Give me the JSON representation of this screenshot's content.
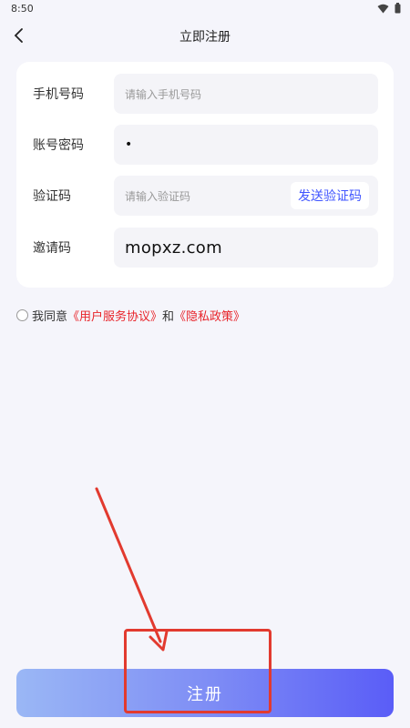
{
  "status_bar": {
    "time": "8:50",
    "icons": [
      "wifi-icon",
      "battery-icon"
    ]
  },
  "nav": {
    "back_icon": "chevron-left-icon",
    "title": "立即注册"
  },
  "form": {
    "phone": {
      "label": "手机号码",
      "placeholder": "请输入手机号码",
      "value": ""
    },
    "password": {
      "label": "账号密码",
      "value": "•"
    },
    "verify_code": {
      "label": "验证码",
      "placeholder": "请输入验证码",
      "send_label": "发送验证码"
    },
    "invite_code": {
      "label": "邀请码",
      "value": "mopxz.com"
    }
  },
  "agreement": {
    "prefix": "我同意",
    "user_agreement": "《用户服务协议》",
    "and": "和",
    "privacy_policy": "《隐私政策》"
  },
  "register_button": {
    "label": "注册"
  },
  "colors": {
    "accent_blue": "#4055ff",
    "link_red": "#e8242a",
    "annotation_red": "#e23a2f",
    "button_gradient_start": "#9ab7f5",
    "button_gradient_end": "#5a5df7"
  }
}
